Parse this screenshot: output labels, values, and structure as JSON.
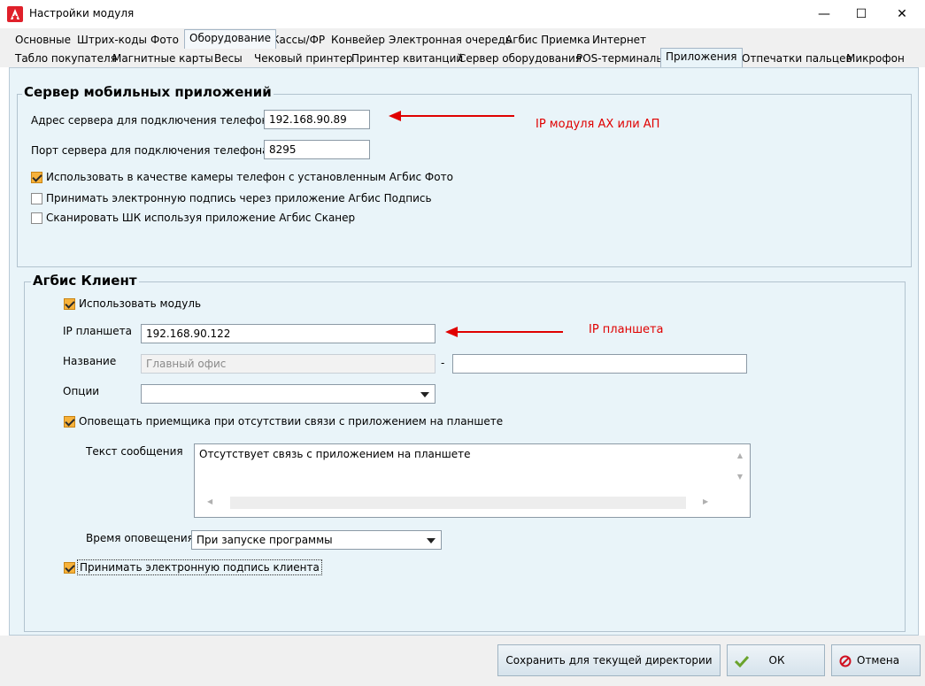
{
  "window": {
    "title": "Настройки модуля",
    "minimize": "—",
    "maximize": "☐",
    "close": "✕"
  },
  "tabs_row1": [
    {
      "label": "Основные"
    },
    {
      "label": "Штрих-коды"
    },
    {
      "label": "Фото"
    },
    {
      "label": "Оборудование",
      "active": true
    },
    {
      "label": "Кассы/ФР"
    },
    {
      "label": "Конвейер"
    },
    {
      "label": "Электронная очередь"
    },
    {
      "label": "Агбис Приемка"
    },
    {
      "label": "Интернет"
    }
  ],
  "tabs_row2": [
    {
      "label": "Табло покупателя"
    },
    {
      "label": "Магнитные карты"
    },
    {
      "label": "Весы"
    },
    {
      "label": "Чековый принтер"
    },
    {
      "label": "Принтер квитанций"
    },
    {
      "label": "Сервер оборудования"
    },
    {
      "label": "POS-терминалы"
    },
    {
      "label": "Приложения",
      "active": true
    },
    {
      "label": "Отпечатки пальцев"
    },
    {
      "label": "Микрофон"
    }
  ],
  "mobile_server": {
    "title": "Сервер мобильных приложений",
    "address_label": "Адрес сервера для подключения телефона:",
    "address_value": "192.168.90.89",
    "port_label": "Порт сервера для подключения телефона:",
    "port_value": "8295",
    "use_camera_label": "Использовать в качестве камеры телефон с установленным Агбис Фото",
    "use_camera_checked": true,
    "signature_label": "Принимать электронную подпись через приложение Агбис Подпись",
    "signature_checked": false,
    "scan_label": "Сканировать ШК используя приложение Агбис Сканер",
    "scan_checked": false,
    "annotation": "IP модуля АХ или АП"
  },
  "agbis_client": {
    "title": "Агбис Клиент",
    "use_module_label": "Использовать модуль",
    "use_module_checked": true,
    "ip_label": "IP планшета",
    "ip_value": "192.168.90.122",
    "ip_annotation": "IP планшета",
    "name_label": "Название",
    "name_placeholder": "Главный офис",
    "name_dash": "-",
    "name_value2": "",
    "options_label": "Опции",
    "options_value": "",
    "notify_label": "Оповещать приемщика при отсутствии связи с приложением на планшете",
    "notify_checked": true,
    "message_label": "Текст сообщения",
    "message_value": "Отсутствует связь с приложением на планшете",
    "notify_time_label": "Время оповещения",
    "notify_time_value": "При запуске программы",
    "accept_signature_label": "Принимать электронную подпись клиента",
    "accept_signature_checked": true
  },
  "footer": {
    "save_dir_label": "Сохранить для текущей директории",
    "ok_label": "ОК",
    "cancel_label": "Отмена"
  },
  "colors": {
    "panel_bg": "#e9f4f9",
    "checkbox_checked": "#f7b23b",
    "annotation": "#e00000",
    "app_icon": "#e0202a"
  }
}
